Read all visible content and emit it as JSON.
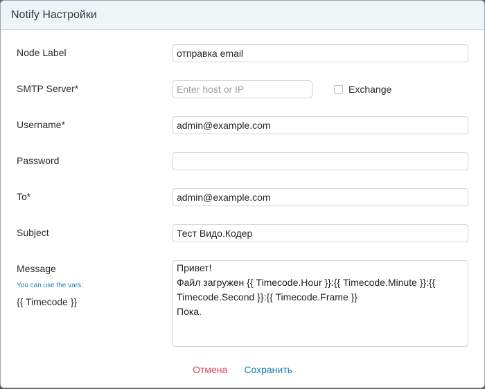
{
  "dialog": {
    "title": "Notify Настройки"
  },
  "form": {
    "node_label": {
      "label": "Node Label",
      "value": "отправка email"
    },
    "smtp_server": {
      "label": "SMTP Server*",
      "placeholder": "Enter host or IP",
      "value": ""
    },
    "exchange": {
      "label": "Exchange",
      "checked": false
    },
    "username": {
      "label": "Username*",
      "value": "admin@example.com"
    },
    "password": {
      "label": "Password",
      "value": ""
    },
    "to": {
      "label": "To*",
      "value": "admin@example.com"
    },
    "subject": {
      "label": "Subject",
      "value": "Тест Видо.Кодер"
    },
    "message": {
      "label": "Message",
      "hint": "You can use the vars:",
      "vars": "{{ Timecode }}",
      "lines": [
        "Привет!",
        "Файл загружен {{ Timecode.Hour }}:{{ Timecode.Minute }}:{{",
        "Timecode.Second }}:{{ Timecode.Frame }}",
        "Пока."
      ]
    }
  },
  "footer": {
    "cancel_label": "Отмена",
    "save_label": "Сохранить"
  }
}
